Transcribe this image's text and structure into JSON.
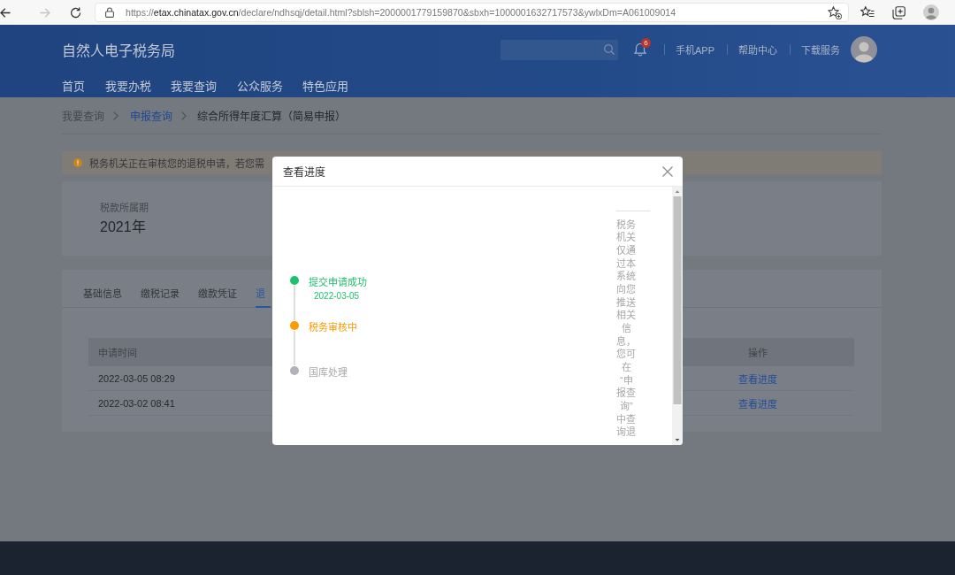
{
  "browser": {
    "back": {
      "disabled": false
    },
    "forward": {
      "disabled": true
    },
    "url": {
      "scheme": "https://",
      "host": "etax.chinatax.gov.cn",
      "path": "/declare/ndhsqj/detail.html?sblsh=2000001779159870&sbxh=1000001632717573&ywlxDm=A061009014"
    }
  },
  "header": {
    "title": "自然人电子税务局",
    "notifications": {
      "count": "6"
    },
    "links": [
      "手机APP",
      "帮助中心",
      "下载服务"
    ],
    "nav": [
      {
        "label": "首页"
      },
      {
        "label": "我要办税"
      },
      {
        "label": "我要查询"
      },
      {
        "label": "公众服务"
      },
      {
        "label": "特色应用"
      }
    ]
  },
  "breadcrumb": [
    {
      "label": "我要查询",
      "kind": "plain"
    },
    {
      "label": "申报查询",
      "kind": "link"
    },
    {
      "label": "综合所得年度汇算（简易申报）",
      "kind": "current"
    }
  ],
  "notice": {
    "text": "税务机关正在审核您的退税申请，若您需"
  },
  "period": {
    "label": "税款所属期",
    "value": "2021年"
  },
  "tabs": [
    {
      "label": "基础信息",
      "selected": false
    },
    {
      "label": "缴税记录",
      "selected": false
    },
    {
      "label": "缴款凭证",
      "selected": false
    },
    {
      "label": "退",
      "selected": true
    }
  ],
  "table": {
    "columns": [
      {
        "label": "申请时间",
        "kind": "text"
      },
      {
        "label": "操作",
        "kind": "action"
      }
    ],
    "rows": [
      {
        "cells": [
          "2022-03-05 08:29",
          "查看进度"
        ]
      },
      {
        "cells": [
          "2022-03-02 08:41",
          "查看进度"
        ]
      }
    ]
  },
  "modal": {
    "title": "查看进度",
    "steps": [
      {
        "label": "提交申请成功",
        "date": "2022-03-05",
        "done": true,
        "active": false
      },
      {
        "label": "税务审核中",
        "done": false,
        "active": true
      },
      {
        "label": "国库处理",
        "done": false,
        "active": false
      }
    ],
    "note": "税务机关仅通过本系统向您推送相关信息，您可在“申报查询”中查询退"
  }
}
